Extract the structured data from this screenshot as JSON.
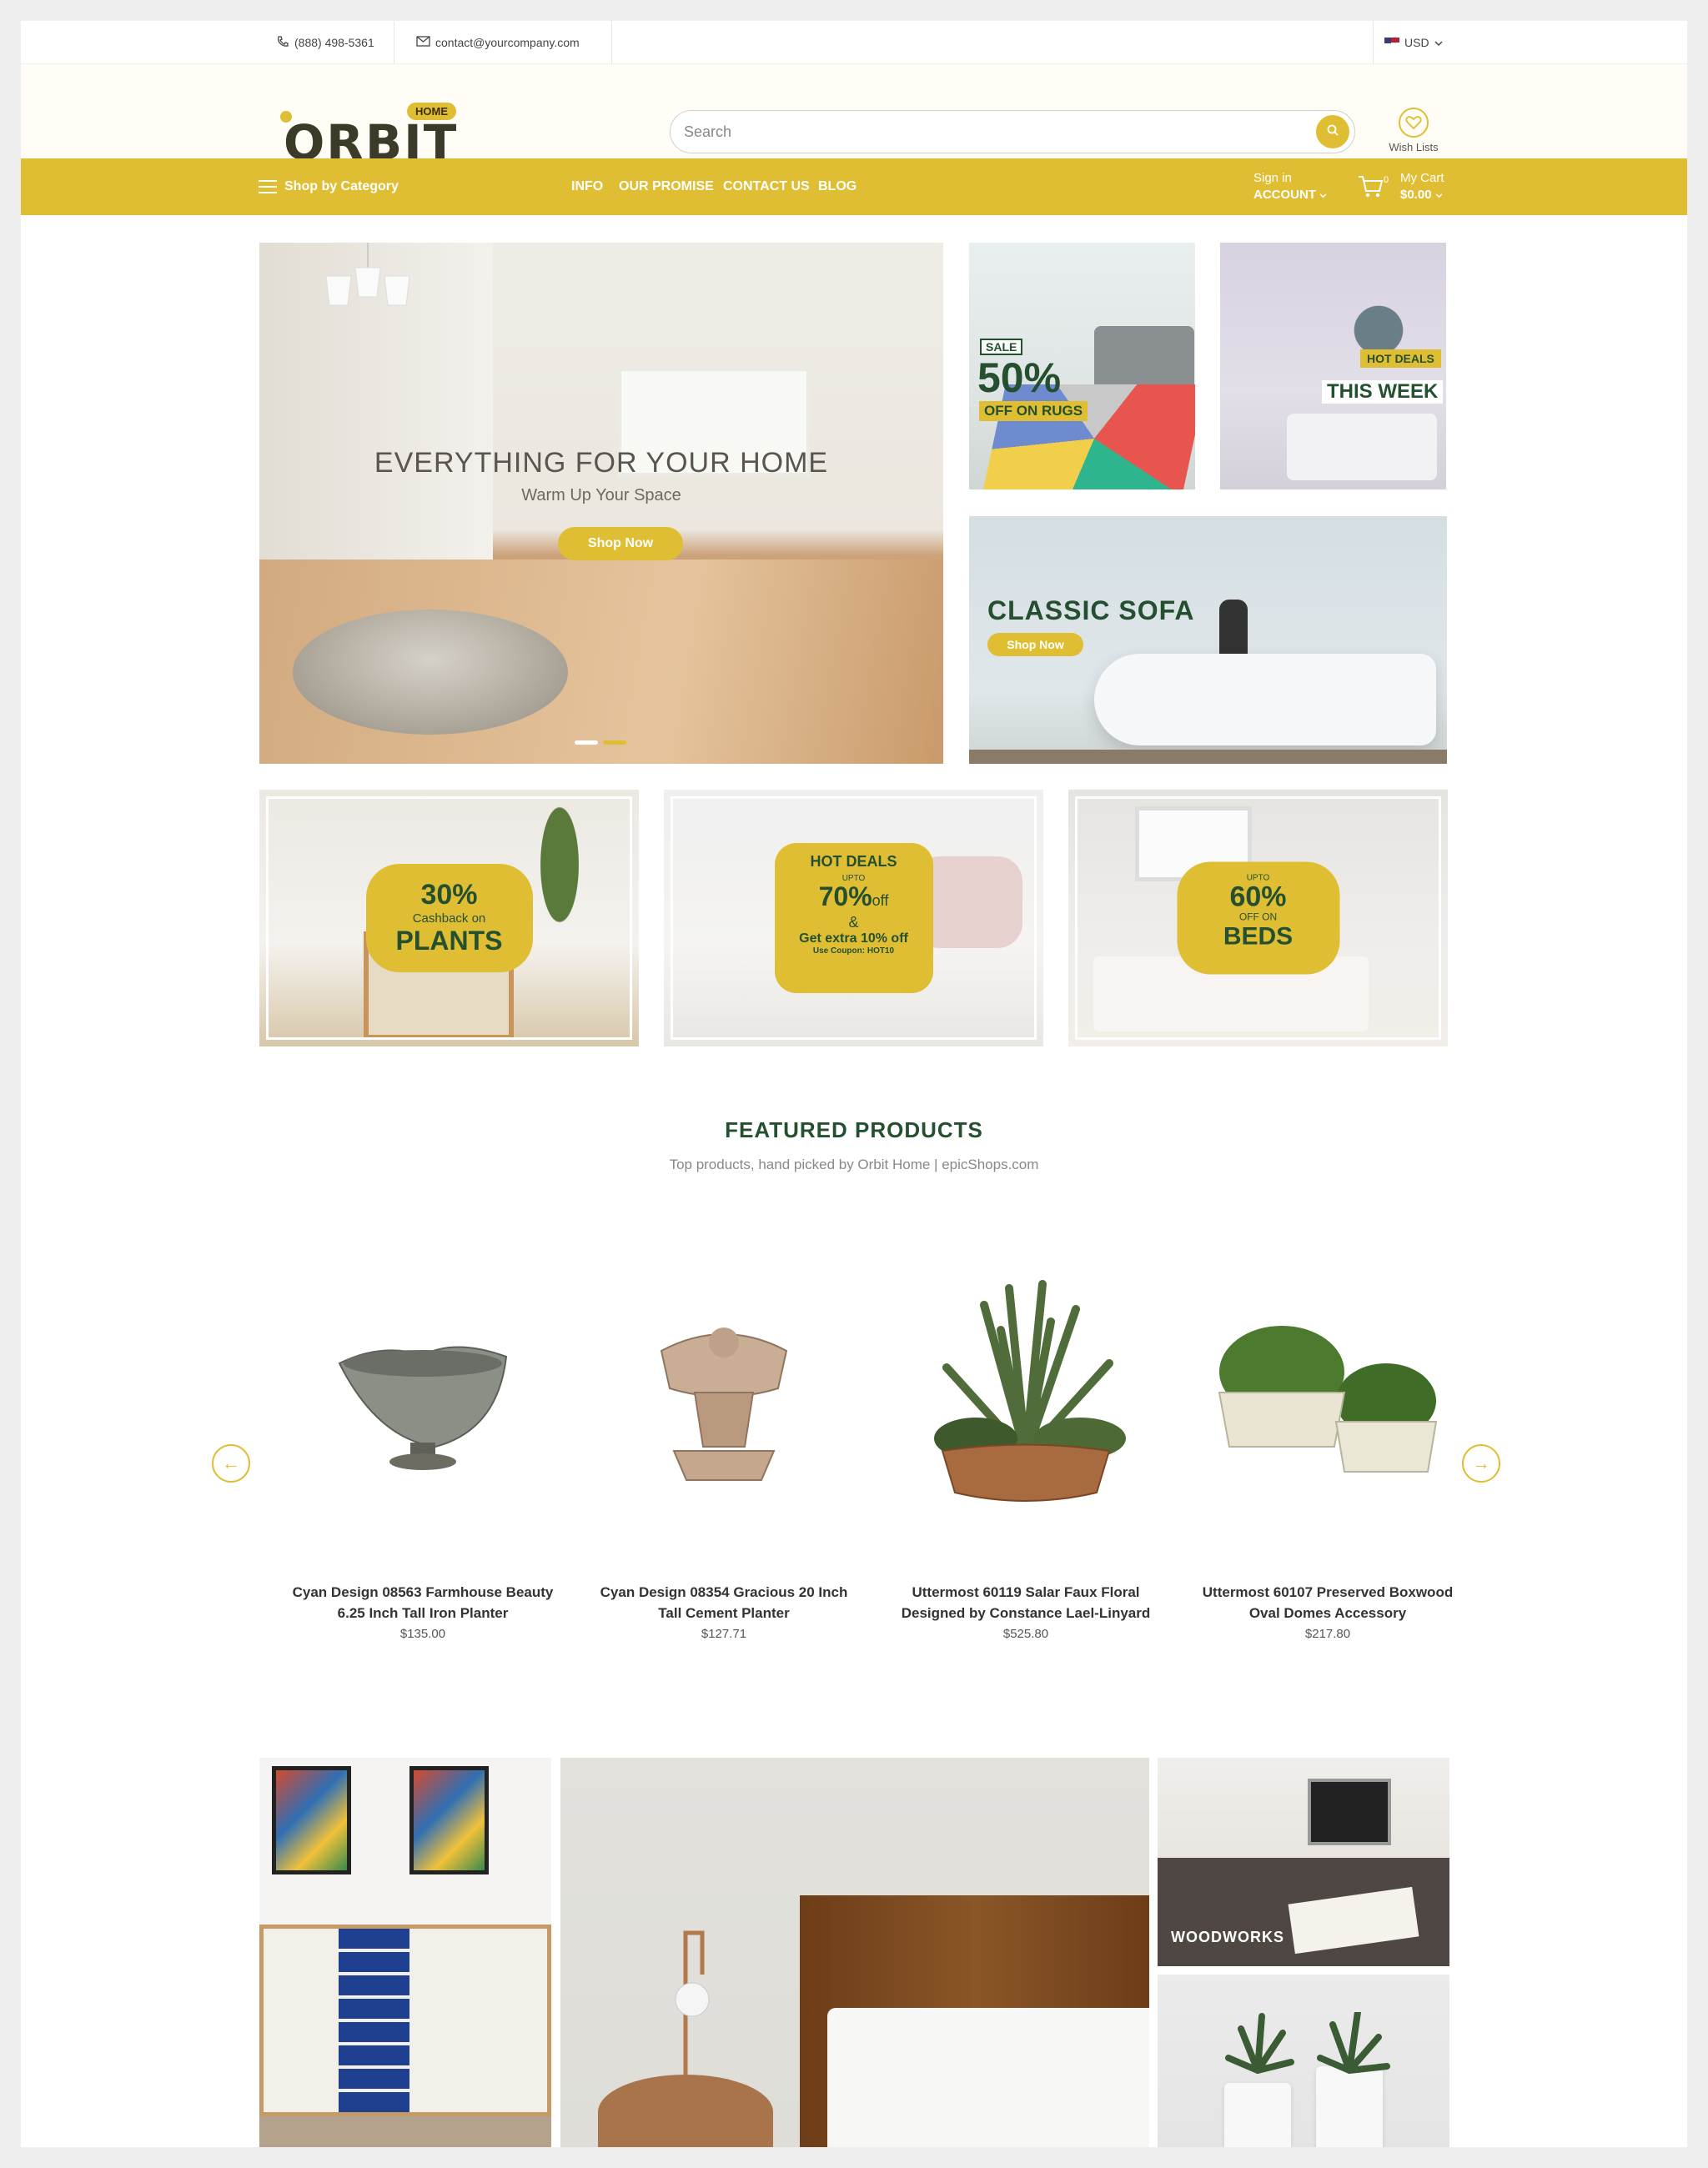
{
  "topbar": {
    "phone": "(888) 498-5361",
    "email": "contact@yourcompany.com",
    "currency": "USD"
  },
  "header": {
    "logo_word": "ORBIT",
    "logo_tag": "HOME",
    "search_placeholder": "Search",
    "wishlist_label": "Wish Lists"
  },
  "nav": {
    "shop_by_category": "Shop by Category",
    "links": [
      "INFO",
      "OUR PROMISE",
      "CONTACT US",
      "BLOG"
    ],
    "signin_small": "Sign in",
    "signin_account": "ACCOUNT",
    "cart_count": "0",
    "cart_label": "My Cart",
    "cart_total": "$0.00"
  },
  "hero": {
    "title": "EVERYTHING FOR YOUR HOME",
    "subtitle": "Warm Up Your Space",
    "button": "Shop Now"
  },
  "banners": {
    "rugs": {
      "sale": "SALE",
      "percent": "50%",
      "text": "OFF ON RUGS"
    },
    "deals": {
      "tag": "HOT DEALS",
      "text": "THIS WEEK"
    },
    "sofa": {
      "title": "CLASSIC SOFA",
      "button": "Shop Now"
    }
  },
  "promos": {
    "plants": {
      "percent": "30%",
      "line": "Cashback on",
      "category": "PLANTS"
    },
    "hot": {
      "title": "HOT DEALS",
      "upto": "UPTO",
      "percent": "70%",
      "off": "off",
      "amp": "&",
      "extra": "Get extra 10% off",
      "coupon": "Use Coupon: HOT10"
    },
    "beds": {
      "upto": "UPTO",
      "percent": "60%",
      "line": "OFF ON",
      "category": "BEDS"
    }
  },
  "featured": {
    "title": "FEATURED PRODUCTS",
    "subtitle": "Top products, hand picked by Orbit Home | epicShops.com",
    "products": [
      {
        "name": "Cyan Design 08563 Farmhouse Beauty 6.25 Inch Tall Iron Planter",
        "price": "$135.00"
      },
      {
        "name": "Cyan Design 08354 Gracious 20 Inch Tall Cement Planter",
        "price": "$127.71"
      },
      {
        "name": "Uttermost 60119 Salar Faux Floral Designed by Constance Lael-Linyard",
        "price": "$525.80"
      },
      {
        "name": "Uttermost 60107 Preserved Boxwood Oval Domes Accessory",
        "price": "$217.80"
      }
    ]
  },
  "gallery": {
    "woodworks": "WOODWORKS"
  },
  "colors": {
    "accent": "#e0be34",
    "heading_green": "#24502f"
  },
  "icons": [
    "phone-icon",
    "mail-icon",
    "flag-icon",
    "search-icon",
    "heart-icon",
    "hamburger-icon",
    "cart-icon",
    "chevron-down-icon",
    "arrow-left-icon",
    "arrow-right-icon"
  ]
}
